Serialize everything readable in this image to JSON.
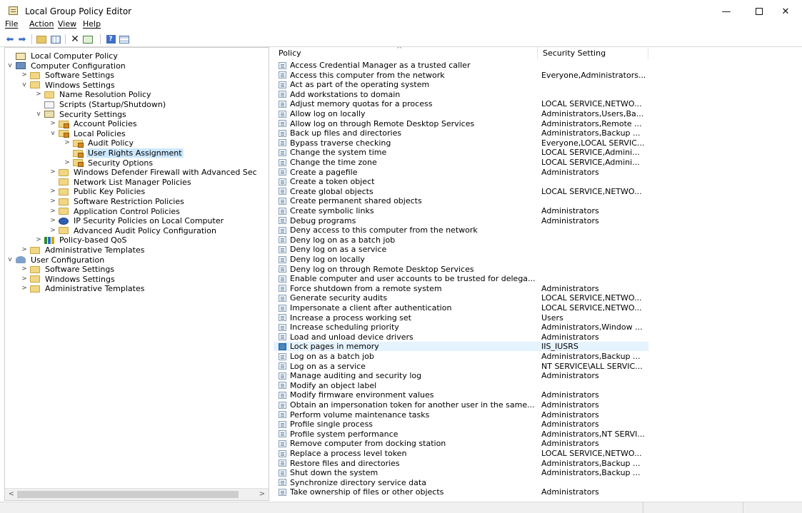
{
  "window": {
    "title": "Local Group Policy Editor",
    "minimize": "—",
    "close": "✕"
  },
  "menu": {
    "file": "File",
    "action": "Action",
    "view": "View",
    "help": "Help"
  },
  "toolbar": {
    "help_glyph": "?"
  },
  "tree": [
    {
      "label": "Local Computer Policy",
      "level": 0,
      "expander": "",
      "icon": "policy-icon"
    },
    {
      "label": "Computer Configuration",
      "level": 0,
      "expander": "v",
      "icon": "computer-icon"
    },
    {
      "label": "Software Settings",
      "level": 1,
      "expander": ">",
      "icon": "folder-icon"
    },
    {
      "label": "Windows Settings",
      "level": 1,
      "expander": "v",
      "icon": "folder-icon"
    },
    {
      "label": "Name Resolution Policy",
      "level": 2,
      "expander": ">",
      "icon": "folder-icon"
    },
    {
      "label": "Scripts (Startup/Shutdown)",
      "level": 2,
      "expander": "",
      "icon": "script-icon"
    },
    {
      "label": "Security Settings",
      "level": 2,
      "expander": "v",
      "icon": "security-settings-icon"
    },
    {
      "label": "Account Policies",
      "level": 3,
      "expander": ">",
      "icon": "folder-lock-icon"
    },
    {
      "label": "Local Policies",
      "level": 3,
      "expander": "v",
      "icon": "folder-lock-icon"
    },
    {
      "label": "Audit Policy",
      "level": 4,
      "expander": ">",
      "icon": "folder-lock-icon"
    },
    {
      "label": "User Rights Assignment",
      "level": 4,
      "expander": "",
      "icon": "folder-lock-icon",
      "selected": true
    },
    {
      "label": "Security Options",
      "level": 4,
      "expander": ">",
      "icon": "folder-lock-icon"
    },
    {
      "label": "Windows Defender Firewall with Advanced Sec",
      "level": 3,
      "expander": ">",
      "icon": "folder-icon"
    },
    {
      "label": "Network List Manager Policies",
      "level": 3,
      "expander": "",
      "icon": "folder-icon"
    },
    {
      "label": "Public Key Policies",
      "level": 3,
      "expander": ">",
      "icon": "folder-icon"
    },
    {
      "label": "Software Restriction Policies",
      "level": 3,
      "expander": ">",
      "icon": "folder-icon"
    },
    {
      "label": "Application Control Policies",
      "level": 3,
      "expander": ">",
      "icon": "folder-icon"
    },
    {
      "label": "IP Security Policies on Local Computer",
      "level": 3,
      "expander": ">",
      "icon": "network-icon"
    },
    {
      "label": "Advanced Audit Policy Configuration",
      "level": 3,
      "expander": ">",
      "icon": "folder-icon"
    },
    {
      "label": "Policy-based QoS",
      "level": 2,
      "expander": ">",
      "icon": "bar-chart-icon"
    },
    {
      "label": "Administrative Templates",
      "level": 1,
      "expander": ">",
      "icon": "folder-icon"
    },
    {
      "label": "User Configuration",
      "level": 0,
      "expander": "v",
      "icon": "users-icon"
    },
    {
      "label": "Software Settings",
      "level": 1,
      "expander": ">",
      "icon": "folder-icon"
    },
    {
      "label": "Windows Settings",
      "level": 1,
      "expander": ">",
      "icon": "folder-icon"
    },
    {
      "label": "Administrative Templates",
      "level": 1,
      "expander": ">",
      "icon": "folder-icon"
    }
  ],
  "list": {
    "columns": {
      "policy": "Policy",
      "setting": "Security Setting"
    },
    "sort_indicator": "^",
    "rows": [
      {
        "policy": "Access Credential Manager as a trusted caller",
        "setting": ""
      },
      {
        "policy": "Access this computer from the network",
        "setting": "Everyone,Administrators..."
      },
      {
        "policy": "Act as part of the operating system",
        "setting": ""
      },
      {
        "policy": "Add workstations to domain",
        "setting": ""
      },
      {
        "policy": "Adjust memory quotas for a process",
        "setting": "LOCAL SERVICE,NETWO..."
      },
      {
        "policy": "Allow log on locally",
        "setting": "Administrators,Users,Ba..."
      },
      {
        "policy": "Allow log on through Remote Desktop Services",
        "setting": "Administrators,Remote ..."
      },
      {
        "policy": "Back up files and directories",
        "setting": "Administrators,Backup ..."
      },
      {
        "policy": "Bypass traverse checking",
        "setting": "Everyone,LOCAL SERVIC..."
      },
      {
        "policy": "Change the system time",
        "setting": "LOCAL SERVICE,Admini..."
      },
      {
        "policy": "Change the time zone",
        "setting": "LOCAL SERVICE,Admini..."
      },
      {
        "policy": "Create a pagefile",
        "setting": "Administrators"
      },
      {
        "policy": "Create a token object",
        "setting": ""
      },
      {
        "policy": "Create global objects",
        "setting": "LOCAL SERVICE,NETWO..."
      },
      {
        "policy": "Create permanent shared objects",
        "setting": ""
      },
      {
        "policy": "Create symbolic links",
        "setting": "Administrators"
      },
      {
        "policy": "Debug programs",
        "setting": "Administrators"
      },
      {
        "policy": "Deny access to this computer from the network",
        "setting": ""
      },
      {
        "policy": "Deny log on as a batch job",
        "setting": ""
      },
      {
        "policy": "Deny log on as a service",
        "setting": ""
      },
      {
        "policy": "Deny log on locally",
        "setting": ""
      },
      {
        "policy": "Deny log on through Remote Desktop Services",
        "setting": ""
      },
      {
        "policy": "Enable computer and user accounts to be trusted for delega...",
        "setting": ""
      },
      {
        "policy": "Force shutdown from a remote system",
        "setting": "Administrators"
      },
      {
        "policy": "Generate security audits",
        "setting": "LOCAL SERVICE,NETWO..."
      },
      {
        "policy": "Impersonate a client after authentication",
        "setting": "LOCAL SERVICE,NETWO..."
      },
      {
        "policy": "Increase a process working set",
        "setting": "Users"
      },
      {
        "policy": "Increase scheduling priority",
        "setting": "Administrators,Window ..."
      },
      {
        "policy": "Load and unload device drivers",
        "setting": "Administrators"
      },
      {
        "policy": "Lock pages in memory",
        "setting": "IIS_IUSRS",
        "selected": true
      },
      {
        "policy": "Log on as a batch job",
        "setting": "Administrators,Backup ..."
      },
      {
        "policy": "Log on as a service",
        "setting": "NT SERVICE\\ALL SERVIC..."
      },
      {
        "policy": "Manage auditing and security log",
        "setting": "Administrators"
      },
      {
        "policy": "Modify an object label",
        "setting": ""
      },
      {
        "policy": "Modify firmware environment values",
        "setting": "Administrators"
      },
      {
        "policy": "Obtain an impersonation token for another user in the same...",
        "setting": "Administrators"
      },
      {
        "policy": "Perform volume maintenance tasks",
        "setting": "Administrators"
      },
      {
        "policy": "Profile single process",
        "setting": "Administrators"
      },
      {
        "policy": "Profile system performance",
        "setting": "Administrators,NT SERVI..."
      },
      {
        "policy": "Remove computer from docking station",
        "setting": "Administrators"
      },
      {
        "policy": "Replace a process level token",
        "setting": "LOCAL SERVICE,NETWO..."
      },
      {
        "policy": "Restore files and directories",
        "setting": "Administrators,Backup ..."
      },
      {
        "policy": "Shut down the system",
        "setting": "Administrators,Backup ..."
      },
      {
        "policy": "Synchronize directory service data",
        "setting": ""
      },
      {
        "policy": "Take ownership of files or other objects",
        "setting": "Administrators"
      }
    ]
  },
  "colors": {
    "selection": "#cce8ff",
    "row_hover": "#e5f3ff",
    "accent": "#3c87c8"
  }
}
